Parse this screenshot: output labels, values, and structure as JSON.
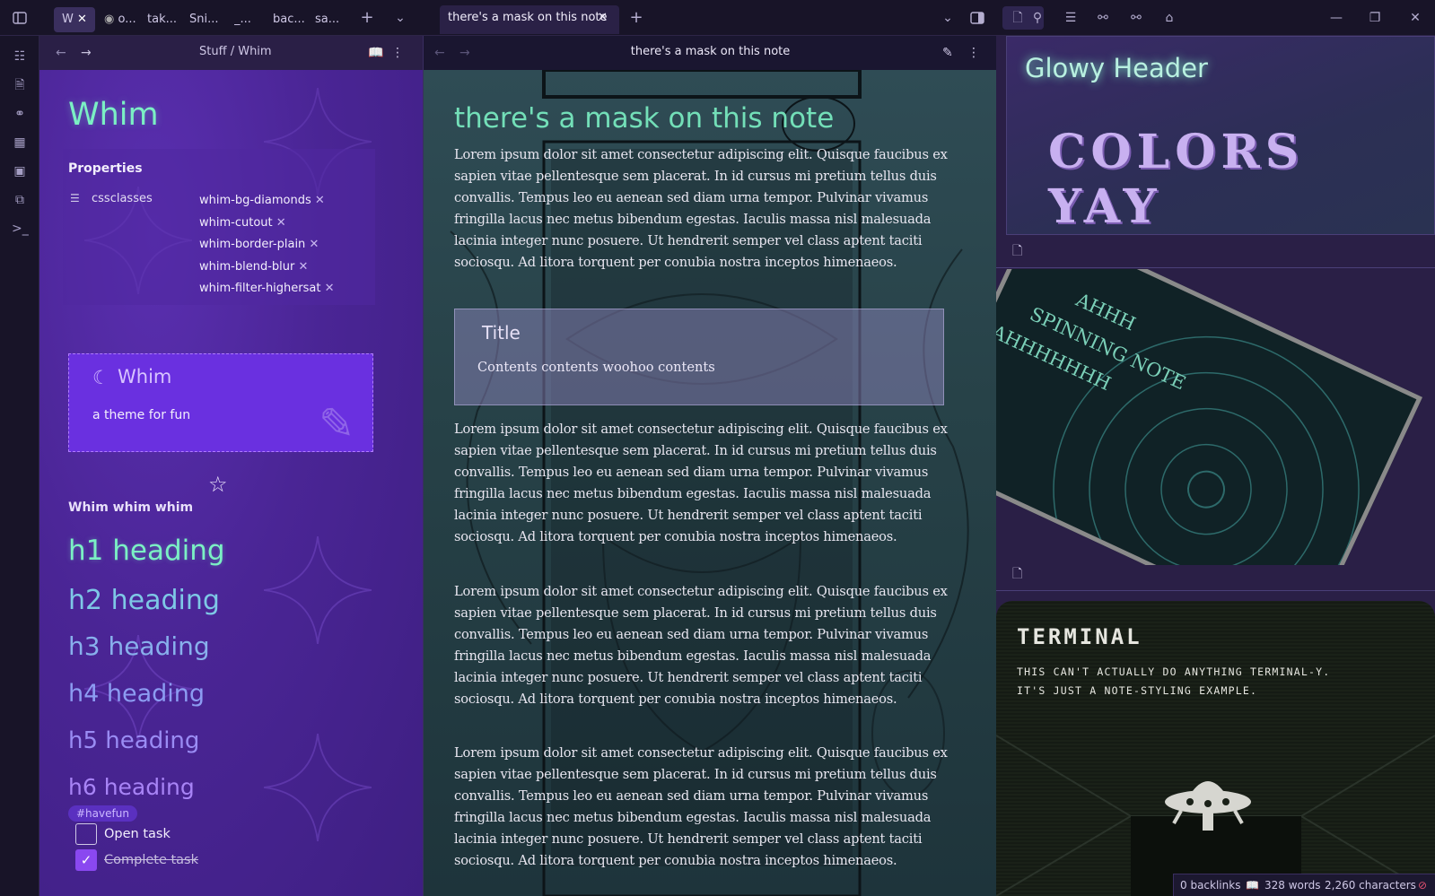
{
  "titlebar": {
    "left_tabs": [
      "W",
      "o...",
      "tak...",
      "Sni...",
      "_...",
      "bac...",
      "sa..."
    ],
    "main_tab": "there's a mask on this note"
  },
  "left": {
    "breadcrumb_parent": "Stuff",
    "breadcrumb_sep": "/",
    "breadcrumb_current": "Whim",
    "title": "Whim",
    "properties_heading": "Properties",
    "property_name": "cssclasses",
    "property_values": [
      "whim-bg-diamonds",
      "whim-cutout",
      "whim-border-plain",
      "whim-blend-blur",
      "whim-filter-highersat"
    ],
    "callout_title": "Whim",
    "callout_body": "a theme for fun",
    "bold_line": "Whim whim whim",
    "headings": [
      "h1 heading",
      "h2 heading",
      "h3 heading",
      "h4 heading",
      "h5 heading",
      "h6 heading"
    ],
    "tag": "#havefun",
    "task_open": "Open task",
    "task_done": "Complete task"
  },
  "middle": {
    "header_title": "there's a mask on this note",
    "title": "there's a mask on this note",
    "paragraph": "Lorem ipsum dolor sit amet consectetur adipiscing elit. Quisque faucibus ex sapien vitae pellentesque sem placerat. In id cursus mi pretium tellus duis convallis. Tempus leo eu aenean sed diam urna tempor. Pulvinar vivamus fringilla lacus nec metus bibendum egestas. Iaculis massa nisl malesuada lacinia integer nunc posuere. Ut hendrerit semper vel class aptent taciti sociosqu. Ad litora torquent per conubia nostra inceptos himenaeos.",
    "callout_title": "Title",
    "callout_body": "Contents contents woohoo contents"
  },
  "right": {
    "glowy_header": "Glowy Header",
    "colors": "COLORS YAY",
    "spinning_lines": [
      "AHHH",
      "SPINNING NOTE",
      "AHHHHHHH"
    ],
    "terminal_title": "TERMINAL",
    "terminal_body_1": "THIS CAN'T ACTUALLY DO ANYTHING TERMINAL-Y.",
    "terminal_body_2": "IT'S JUST A NOTE-STYLING EXAMPLE."
  },
  "status": {
    "backlinks": "0 backlinks",
    "words": "328 words",
    "chars": "2,260 characters"
  },
  "colors": {
    "accent": "#7bf0c4",
    "purple": "#4a2590",
    "h_color": "#7ec8e6"
  }
}
